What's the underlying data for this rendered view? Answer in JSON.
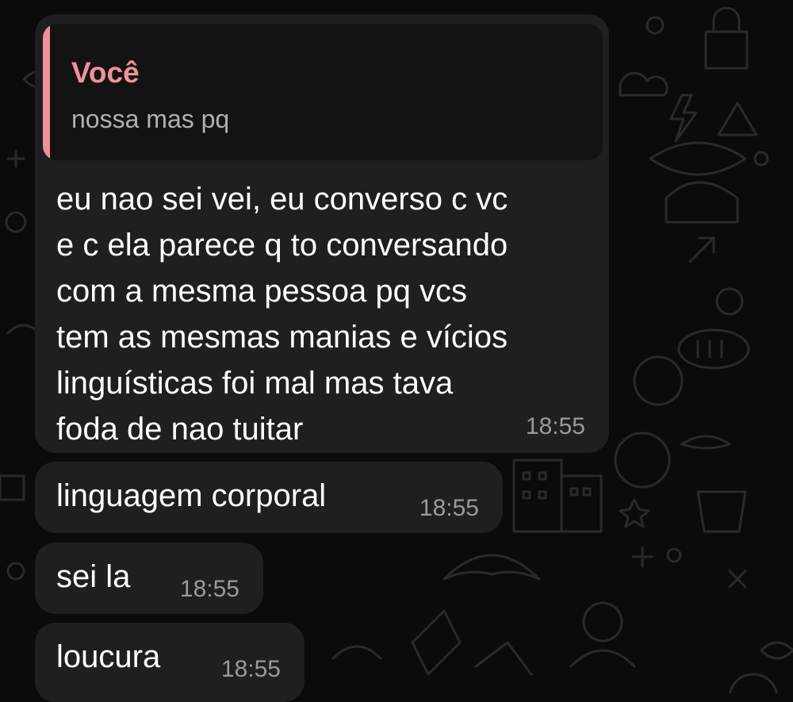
{
  "chat": {
    "background_color": "#0b0b0b",
    "doodle_color": "#2a2a2c",
    "bubble_color": "#1f1f21",
    "quote_bar_color": "#f0919c",
    "messages": [
      {
        "reply_to": {
          "author": "Você",
          "text": "nossa mas pq"
        },
        "text": "eu nao sei vei, eu converso c vc\ne c ela parece q to conversando\ncom a mesma pessoa pq vcs\ntem as mesmas manias e vícios\nlinguísticas foi mal mas tava\nfoda de nao tuitar",
        "time": "18:55"
      },
      {
        "text": "linguagem corporal",
        "time": "18:55"
      },
      {
        "text": "sei la",
        "time": "18:55"
      },
      {
        "text": "loucura",
        "time": "18:55"
      }
    ]
  }
}
